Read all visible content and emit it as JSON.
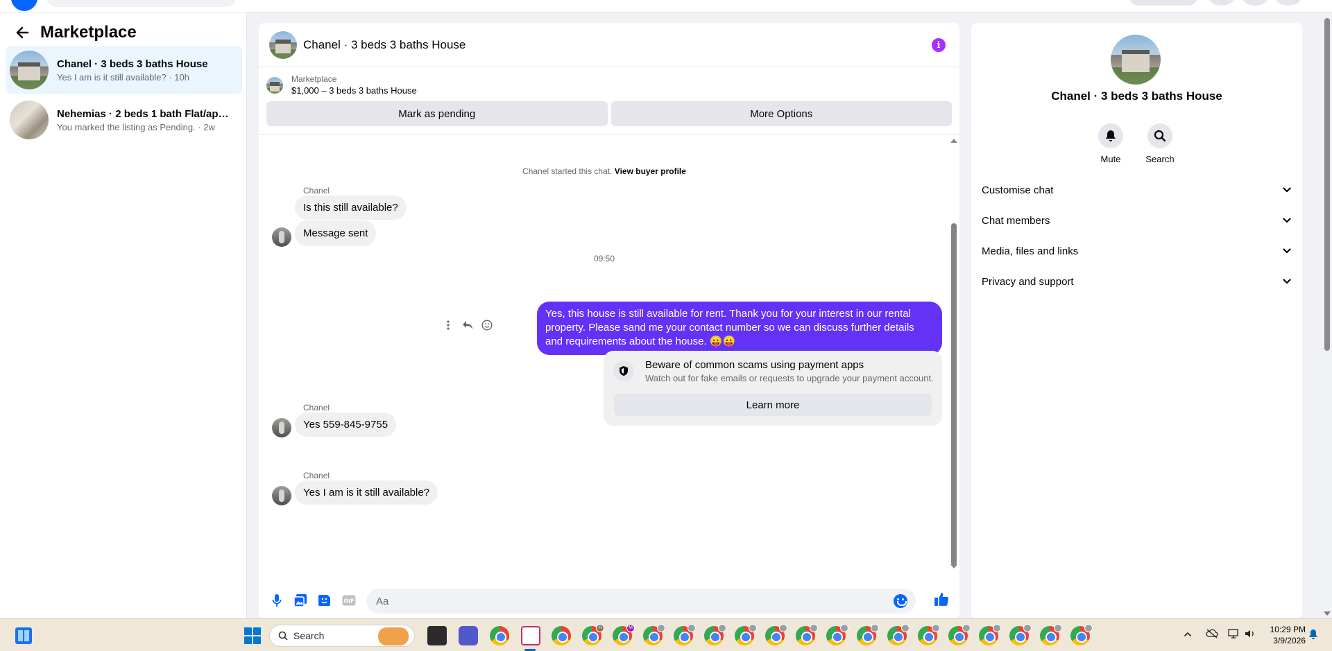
{
  "sidebar": {
    "title": "Marketplace",
    "conversations": [
      {
        "title": "Chanel · 3 beds 3 baths House",
        "preview": "Yes I am is it still available? · 10h"
      },
      {
        "title": "Nehemias · 2 beds 1 bath Flat/apar...",
        "preview": "You marked the listing as Pending. · 2w"
      }
    ]
  },
  "chat": {
    "title": "Chanel · 3 beds 3 baths House",
    "listing_label": "Marketplace",
    "listing_price": "$1,000 – 3 beds 3 baths House",
    "mark_pending_label": "Mark as pending",
    "more_options_label": "More Options",
    "started_text": "Chanel started this chat.",
    "view_buyer_profile": "View buyer profile",
    "messages": {
      "m1_sender": "Chanel",
      "m1_text": "Is this still available?",
      "m2_text": "Message sent",
      "timestamp": "09:50",
      "out_text": "Yes, this house is still available for rent. Thank you for your interest in our rental property. Please sand me your contact number so we can discuss further details and requirements about the house. 😛😛",
      "m3_sender": "Chanel",
      "m3_text": "Yes 559-845-9755",
      "m4_sender": "Chanel",
      "m4_text": "Yes I am is it still available?"
    },
    "scam_notice": {
      "title": "Beware of common scams using payment apps",
      "subtitle": "Watch out for fake emails or requests to upgrade your payment account.",
      "learn_more": "Learn more"
    },
    "composer_placeholder": "Aa"
  },
  "details": {
    "name": "Chanel · 3 beds 3 baths House",
    "mute_label": "Mute",
    "search_label": "Search",
    "sections": [
      "Customise chat",
      "Chat members",
      "Media, files and links",
      "Privacy and support"
    ]
  },
  "taskbar": {
    "search_label": "Search",
    "time": "10:29 PM",
    "date": "3/9/2026",
    "app_badges": [
      "H",
      "M"
    ]
  },
  "colors": {
    "accent": "#0866ff",
    "outgoing_bubble": "#6332f6",
    "info_button": "#a033ff",
    "active_conversation": "#ebf5ff"
  }
}
